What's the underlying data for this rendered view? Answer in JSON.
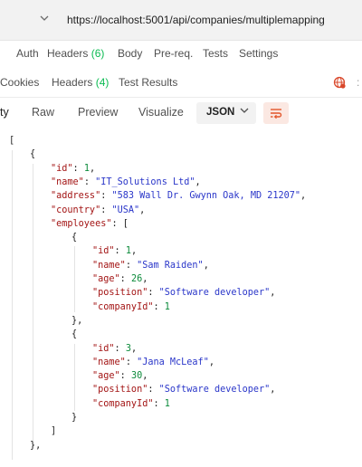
{
  "urlbar": {
    "url": "https://localhost:5001/api/companies/multiplemapping"
  },
  "request_tabs": {
    "auth": "Auth",
    "headers": "Headers",
    "headers_count": "(6)",
    "body": "Body",
    "prereq": "Pre-req.",
    "tests": "Tests",
    "settings": "Settings"
  },
  "response_tabs": {
    "cookies": "Cookies",
    "headers": "Headers",
    "headers_count": "(4)",
    "test_results": "Test Results"
  },
  "view_bar": {
    "pretty": "ty",
    "raw": "Raw",
    "preview": "Preview",
    "visualize": "Visualize",
    "format": "JSON"
  },
  "json_lines": [
    {
      "indent": 0,
      "parts": [
        [
          "p",
          "["
        ]
      ]
    },
    {
      "indent": 1,
      "parts": [
        [
          "p",
          "{"
        ]
      ]
    },
    {
      "indent": 2,
      "parts": [
        [
          "k",
          "\"id\""
        ],
        [
          "p",
          ": "
        ],
        [
          "n",
          "1"
        ],
        [
          "p",
          ","
        ]
      ]
    },
    {
      "indent": 2,
      "parts": [
        [
          "k",
          "\"name\""
        ],
        [
          "p",
          ": "
        ],
        [
          "s",
          "\"IT_Solutions Ltd\""
        ],
        [
          "p",
          ","
        ]
      ]
    },
    {
      "indent": 2,
      "parts": [
        [
          "k",
          "\"address\""
        ],
        [
          "p",
          ": "
        ],
        [
          "s",
          "\"583 Wall Dr. Gwynn Oak, MD 21207\""
        ],
        [
          "p",
          ","
        ]
      ]
    },
    {
      "indent": 2,
      "parts": [
        [
          "k",
          "\"country\""
        ],
        [
          "p",
          ": "
        ],
        [
          "s",
          "\"USA\""
        ],
        [
          "p",
          ","
        ]
      ]
    },
    {
      "indent": 2,
      "parts": [
        [
          "k",
          "\"employees\""
        ],
        [
          "p",
          ": ["
        ]
      ]
    },
    {
      "indent": 3,
      "parts": [
        [
          "p",
          "{"
        ]
      ]
    },
    {
      "indent": 4,
      "parts": [
        [
          "k",
          "\"id\""
        ],
        [
          "p",
          ": "
        ],
        [
          "n",
          "1"
        ],
        [
          "p",
          ","
        ]
      ]
    },
    {
      "indent": 4,
      "parts": [
        [
          "k",
          "\"name\""
        ],
        [
          "p",
          ": "
        ],
        [
          "s",
          "\"Sam Raiden\""
        ],
        [
          "p",
          ","
        ]
      ]
    },
    {
      "indent": 4,
      "parts": [
        [
          "k",
          "\"age\""
        ],
        [
          "p",
          ": "
        ],
        [
          "n",
          "26"
        ],
        [
          "p",
          ","
        ]
      ]
    },
    {
      "indent": 4,
      "parts": [
        [
          "k",
          "\"position\""
        ],
        [
          "p",
          ": "
        ],
        [
          "s",
          "\"Software developer\""
        ],
        [
          "p",
          ","
        ]
      ]
    },
    {
      "indent": 4,
      "parts": [
        [
          "k",
          "\"companyId\""
        ],
        [
          "p",
          ": "
        ],
        [
          "n",
          "1"
        ]
      ]
    },
    {
      "indent": 3,
      "parts": [
        [
          "p",
          "},"
        ]
      ]
    },
    {
      "indent": 3,
      "parts": [
        [
          "p",
          "{"
        ]
      ]
    },
    {
      "indent": 4,
      "parts": [
        [
          "k",
          "\"id\""
        ],
        [
          "p",
          ": "
        ],
        [
          "n",
          "3"
        ],
        [
          "p",
          ","
        ]
      ]
    },
    {
      "indent": 4,
      "parts": [
        [
          "k",
          "\"name\""
        ],
        [
          "p",
          ": "
        ],
        [
          "s",
          "\"Jana McLeaf\""
        ],
        [
          "p",
          ","
        ]
      ]
    },
    {
      "indent": 4,
      "parts": [
        [
          "k",
          "\"age\""
        ],
        [
          "p",
          ": "
        ],
        [
          "n",
          "30"
        ],
        [
          "p",
          ","
        ]
      ]
    },
    {
      "indent": 4,
      "parts": [
        [
          "k",
          "\"position\""
        ],
        [
          "p",
          ": "
        ],
        [
          "s",
          "\"Software developer\""
        ],
        [
          "p",
          ","
        ]
      ]
    },
    {
      "indent": 4,
      "parts": [
        [
          "k",
          "\"companyId\""
        ],
        [
          "p",
          ": "
        ],
        [
          "n",
          "1"
        ]
      ]
    },
    {
      "indent": 3,
      "parts": [
        [
          "p",
          "}"
        ]
      ]
    },
    {
      "indent": 2,
      "parts": [
        [
          "p",
          "]"
        ]
      ]
    },
    {
      "indent": 1,
      "parts": [
        [
          "p",
          "},"
        ]
      ]
    }
  ]
}
